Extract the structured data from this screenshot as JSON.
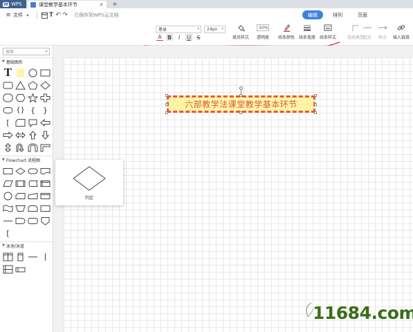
{
  "tabbar": {
    "app_tab": "WPS",
    "doc_tab": "课堂教学基本环节",
    "close_glyph": "×",
    "add_glyph": "+"
  },
  "menubar": {
    "file_menu": "文件",
    "saved_status": "已保存到WPS云文档",
    "right_tabs": [
      "编辑",
      "排列",
      "页面"
    ]
  },
  "ribbon": {
    "font_name": "黑体",
    "font_size": "24px",
    "format_buttons": [
      "A",
      "B",
      "I",
      "U",
      "S"
    ],
    "opacity_value": "50%",
    "tools": [
      {
        "label": "填充样式",
        "icon": "fill-icon"
      },
      {
        "label": "透明度",
        "icon": "opacity-icon"
      },
      {
        "label": "线条颜色",
        "icon": "pen-icon"
      },
      {
        "label": "线条宽度",
        "icon": "line-width-icon"
      },
      {
        "label": "线条样式",
        "icon": "line-style-icon"
      },
      {
        "label": "连线类型",
        "icon": "connector-icon"
      },
      {
        "label": "起点",
        "icon": "line-start-icon"
      },
      {
        "label": "终点",
        "icon": "line-end-icon"
      },
      {
        "label": "插入链接",
        "icon": "link-icon"
      }
    ]
  },
  "sidebar": {
    "search_placeholder": "搜索",
    "sections": [
      "基础图形",
      "Flowchart 流程图",
      "泳池/泳道"
    ]
  },
  "canvas": {
    "title_text": "六部教学法课堂教学基本环节",
    "title_fill": "#fcf4a3",
    "title_border": "#e2574c",
    "title_text_color": "#d85b4a"
  },
  "preview": {
    "caption": "判定"
  },
  "watermark": {
    "text": "11684.com"
  },
  "colors": {
    "accent": "#3f7fe0",
    "wps_tab": "#3f5f8f",
    "annotation_red": "#d02020"
  }
}
